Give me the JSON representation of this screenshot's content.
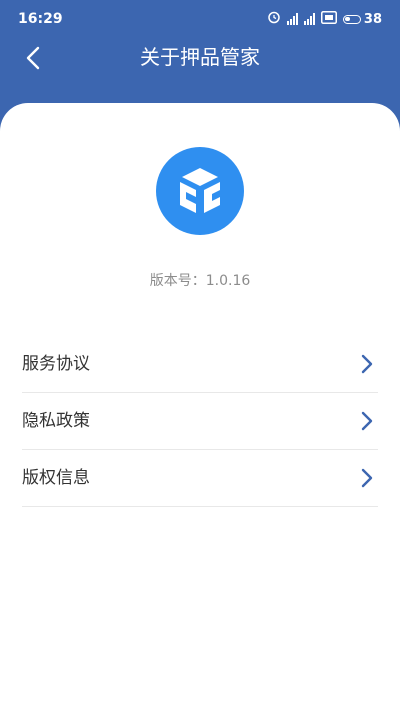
{
  "status_bar": {
    "time": "16:29",
    "battery_level": "38",
    "icons": [
      "alarm-icon",
      "signal-icon",
      "signal-icon",
      "hd-icon",
      "battery-icon"
    ]
  },
  "nav": {
    "title": "关于押品管家",
    "back_icon": "chevron-left-icon"
  },
  "app": {
    "logo_icon": "cube-logo-icon",
    "version_text": "版本号：1.0.16"
  },
  "menu": {
    "items": [
      {
        "label": "服务协议",
        "icon": "chevron-right-icon"
      },
      {
        "label": "隐私政策",
        "icon": "chevron-right-icon"
      },
      {
        "label": "版权信息",
        "icon": "chevron-right-icon"
      }
    ]
  },
  "colors": {
    "header_bg": "#3c66b0",
    "logo_bg": "#2f8ff0",
    "chevron": "#3c66b0",
    "text": "#333333",
    "muted": "#8c8c8c"
  }
}
